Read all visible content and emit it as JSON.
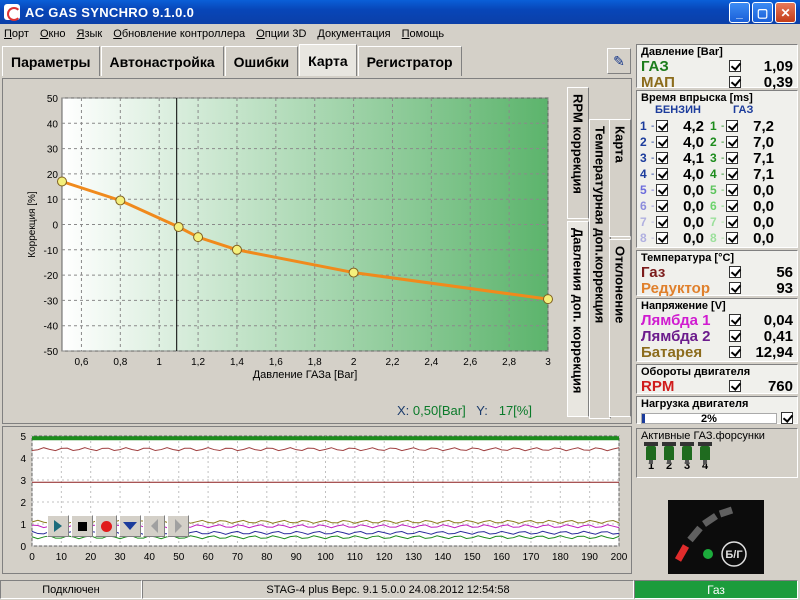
{
  "window": {
    "title": "AC GAS SYNCHRO  9.1.0.0",
    "min": "_",
    "max": "▢",
    "close": "✕"
  },
  "menu": [
    "Порт",
    "Окно",
    "Язык",
    "Обновление контроллера",
    "Опции 3D",
    "Документация",
    "Помощь"
  ],
  "tabs": [
    "Параметры",
    "Автонастройка",
    "Ошибки",
    "Карта",
    "Регистратор"
  ],
  "active_tab": "Карта",
  "side_tabs": [
    "RPM коррекция",
    "Давления доп. коррекция",
    "Температурная доп.коррекция",
    "Карта",
    "Отклонение"
  ],
  "readout": {
    "x_label": "X:",
    "x_value": "0,50[Bar]",
    "y_label": "Y:",
    "y_value": "17[%]"
  },
  "chart_data": [
    {
      "type": "line",
      "xlabel": "Давление ГАЗа [Bar]",
      "ylabel": "Коррекция [%]",
      "xlim": [
        0.5,
        3.0
      ],
      "ylim": [
        -50,
        50
      ],
      "x_ticks": [
        "0,6",
        "0,8",
        "1",
        "1,2",
        "1,4",
        "1,6",
        "1,8",
        "2",
        "2,2",
        "2,4",
        "2,6",
        "2,8",
        "3"
      ],
      "y_ticks": [
        "50",
        "40",
        "30",
        "20",
        "10",
        "0",
        "-10",
        "-20",
        "-30",
        "-40",
        "-50"
      ],
      "grid": true,
      "cursor_x": 1.09,
      "series": [
        {
          "x": [
            0.5,
            0.8,
            1.1,
            1.2,
            1.4,
            2.0,
            3.0
          ],
          "y": [
            17,
            9.5,
            -1,
            -5,
            -10,
            -19,
            -29.5
          ],
          "color": "#f08a1c"
        }
      ]
    },
    {
      "type": "line",
      "xlim": [
        0,
        200
      ],
      "ylim": [
        0,
        5
      ],
      "x_ticks": [
        "0",
        "10",
        "20",
        "30",
        "40",
        "50",
        "60",
        "70",
        "80",
        "90",
        "100",
        "110",
        "120",
        "130",
        "140",
        "150",
        "160",
        "170",
        "180",
        "190",
        "200"
      ],
      "y_ticks": [
        "0",
        "1",
        "2",
        "3",
        "4",
        "5"
      ],
      "grid": true,
      "series": [
        {
          "x": [
            0,
            200
          ],
          "y": [
            4.9,
            4.9
          ],
          "color": "#1c8c1c"
        },
        {
          "x": [
            0,
            200
          ],
          "y": [
            4.4,
            4.4
          ],
          "color": "#a04040"
        },
        {
          "x": [
            0,
            200
          ],
          "y": [
            2.9,
            2.9
          ],
          "color": "#8c1c1c"
        },
        {
          "x": [
            0,
            200
          ],
          "y": [
            1.1,
            1.1
          ],
          "color": "#8c7c1c"
        },
        {
          "x": [
            0,
            200
          ],
          "y": [
            0.9,
            0.9
          ],
          "color": "#c020c0"
        },
        {
          "x": [
            0,
            200
          ],
          "y": [
            0.6,
            0.6
          ],
          "color": "#2c2c9c"
        },
        {
          "x": [
            0,
            200
          ],
          "y": [
            0.4,
            0.4
          ],
          "color": "#1c8c1c"
        }
      ]
    }
  ],
  "pressure": {
    "title": "Давление [Bar]",
    "rows": [
      {
        "label": "ГАЗ",
        "value": "1,09",
        "color": "#1c7c1c"
      },
      {
        "label": "МАП",
        "value": "0,39",
        "color": "#8c6c1c"
      }
    ]
  },
  "injection": {
    "title": "Время впрыска [ms]",
    "petrol_header": "БЕНЗИН",
    "gas_header": "ГАЗ",
    "petrol": [
      {
        "n": "1",
        "v": "4,2"
      },
      {
        "n": "2",
        "v": "4,0"
      },
      {
        "n": "3",
        "v": "4,1"
      },
      {
        "n": "4",
        "v": "4,0"
      },
      {
        "n": "5",
        "v": "0,0"
      },
      {
        "n": "6",
        "v": "0,0"
      },
      {
        "n": "7",
        "v": "0,0"
      },
      {
        "n": "8",
        "v": "0,0"
      }
    ],
    "gas": [
      {
        "n": "1",
        "v": "7,2"
      },
      {
        "n": "2",
        "v": "7,0"
      },
      {
        "n": "3",
        "v": "7,1"
      },
      {
        "n": "4",
        "v": "7,1"
      },
      {
        "n": "5",
        "v": "0,0"
      },
      {
        "n": "6",
        "v": "0,0"
      },
      {
        "n": "7",
        "v": "0,0"
      },
      {
        "n": "8",
        "v": "0,0"
      }
    ]
  },
  "temperature": {
    "title": "Температура  [°C]",
    "rows": [
      {
        "label": "Газ",
        "value": "56",
        "color": "#7c1c1c"
      },
      {
        "label": "Редуктор",
        "value": "93",
        "color": "#e0802c"
      }
    ]
  },
  "voltage": {
    "title": "Напряжение [V]",
    "rows": [
      {
        "label": "Лямбда 1",
        "value": "0,04",
        "color": "#d01cd0"
      },
      {
        "label": "Лямбда 2",
        "value": "0,41",
        "color": "#6c1c8c"
      },
      {
        "label": "Батарея",
        "value": "12,94",
        "color": "#8c6c1c"
      }
    ]
  },
  "rpm": {
    "title": "Обороты двигателя",
    "label": "RPM",
    "value": "760",
    "color": "#d01c1c"
  },
  "load": {
    "title": "Нагрузка двигателя",
    "value": "2%",
    "fraction": 0.02
  },
  "active_injectors": {
    "title": "Активные ГАЗ.форсунки",
    "labels": [
      "1",
      "2",
      "3",
      "4"
    ]
  },
  "switch": {
    "label": "Б/Г"
  },
  "status": {
    "connection": "Подключен",
    "device": "STAG-4 plus   Верс. 9.1  5.0.0    24.08.2012 12:54:58",
    "mode": "Газ"
  }
}
